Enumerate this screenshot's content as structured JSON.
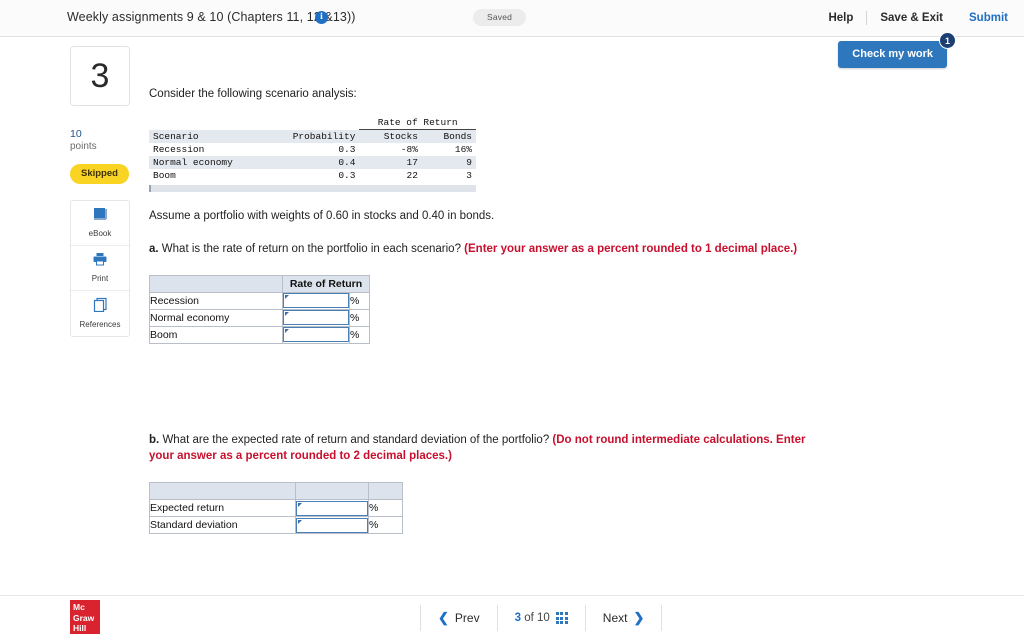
{
  "header": {
    "title": "Weekly assignments 9 & 10 (Chapters 11, 12 &13))",
    "info_icon": "info-icon",
    "saved_status": "Saved",
    "help_label": "Help",
    "save_exit_label": "Save & Exit",
    "submit_label": "Submit",
    "check_my_work_label": "Check my work",
    "check_my_work_badge": "1",
    "accent_blue": "#2f77bd",
    "badge_navy": "#1b3f73"
  },
  "rail": {
    "question_number": "3",
    "points_value": "10",
    "points_unit": "points",
    "status_badge": "Skipped",
    "status_color": "#f9d423",
    "tools": [
      {
        "label": "eBook",
        "icon": "book-icon"
      },
      {
        "label": "Print",
        "icon": "printer-icon"
      },
      {
        "label": "References",
        "icon": "documents-icon"
      }
    ]
  },
  "main": {
    "intro": "Consider the following scenario analysis:",
    "assume": "Assume a portfolio with weights of 0.60 in stocks and 0.40 in bonds.",
    "part_a": {
      "label": "a.",
      "question": "What is the rate of return on the portfolio in each scenario?",
      "instruction": "(Enter your answer as a percent rounded to 1 decimal place.)"
    },
    "part_b": {
      "label": "b.",
      "question": "What are the expected rate of return and standard deviation of the portfolio?",
      "instruction": "(Do not round intermediate calculations. Enter your answer as a percent rounded to 2 decimal places.)"
    }
  },
  "scenario_table": {
    "group_header": "Rate of Return",
    "columns": [
      "Scenario",
      "Probability",
      "Stocks",
      "Bonds"
    ],
    "rows": [
      {
        "scenario": "Recession",
        "probability": "0.3",
        "stocks": "-8%",
        "bonds": "16%"
      },
      {
        "scenario": "Normal economy",
        "probability": "0.4",
        "stocks": "17",
        "bonds": "9"
      },
      {
        "scenario": "Boom",
        "probability": "0.3",
        "stocks": "22",
        "bonds": "3"
      }
    ]
  },
  "answer_table_a": {
    "header_blank": "",
    "header_rate": "Rate of Return",
    "rows": [
      {
        "label": "Recession",
        "value": "",
        "unit": "%"
      },
      {
        "label": "Normal economy",
        "value": "",
        "unit": "%"
      },
      {
        "label": "Boom",
        "value": "",
        "unit": "%"
      }
    ]
  },
  "answer_table_b": {
    "rows": [
      {
        "label": "Expected return",
        "value": "",
        "unit": "%"
      },
      {
        "label": "Standard deviation",
        "value": "",
        "unit": "%"
      }
    ]
  },
  "footer": {
    "logo_line1": "Mc",
    "logo_line2": "Graw",
    "logo_line3": "Hill",
    "prev_label": "Prev",
    "next_label": "Next",
    "page_current": "3",
    "page_of": "of",
    "page_total": "10",
    "grid_icon": "grid-icon"
  }
}
